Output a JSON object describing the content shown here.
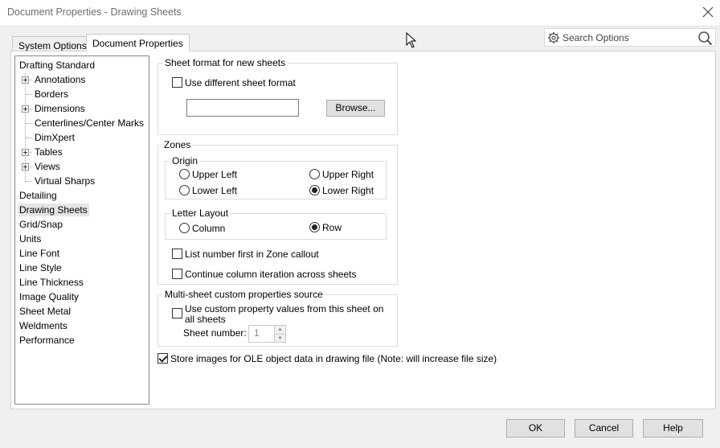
{
  "window": {
    "title": "Document Properties - Drawing Sheets"
  },
  "tabs": [
    {
      "label": "System Options",
      "active": false
    },
    {
      "label": "Document Properties",
      "active": true
    }
  ],
  "search": {
    "placeholder": "Search Options"
  },
  "tree": {
    "items": [
      {
        "label": "Drafting Standard",
        "level": 0
      },
      {
        "label": "Annotations",
        "level": 1,
        "expandable": true
      },
      {
        "label": "Borders",
        "level": 1
      },
      {
        "label": "Dimensions",
        "level": 1,
        "expandable": true
      },
      {
        "label": "Centerlines/Center Marks",
        "level": 1
      },
      {
        "label": "DimXpert",
        "level": 1
      },
      {
        "label": "Tables",
        "level": 1,
        "expandable": true
      },
      {
        "label": "Views",
        "level": 1,
        "expandable": true
      },
      {
        "label": "Virtual Sharps",
        "level": 1
      },
      {
        "label": "Detailing",
        "level": 0
      },
      {
        "label": "Drawing Sheets",
        "level": 0,
        "selected": true
      },
      {
        "label": "Grid/Snap",
        "level": 0
      },
      {
        "label": "Units",
        "level": 0
      },
      {
        "label": "Line Font",
        "level": 0
      },
      {
        "label": "Line Style",
        "level": 0
      },
      {
        "label": "Line Thickness",
        "level": 0
      },
      {
        "label": "Image Quality",
        "level": 0
      },
      {
        "label": "Sheet Metal",
        "level": 0
      },
      {
        "label": "Weldments",
        "level": 0
      },
      {
        "label": "Performance",
        "level": 0
      }
    ]
  },
  "sheet_format": {
    "legend": "Sheet format for new sheets",
    "use_different_label": "Use different sheet format",
    "use_different_checked": false,
    "path_value": "",
    "browse_label": "Browse..."
  },
  "zones": {
    "legend": "Zones",
    "origin": {
      "legend": "Origin",
      "upper_left": "Upper Left",
      "upper_right": "Upper Right",
      "lower_left": "Lower Left",
      "lower_right": "Lower Right",
      "selected": "Lower Right"
    },
    "letter_layout": {
      "legend": "Letter Layout",
      "column": "Column",
      "row": "Row",
      "selected": "Row"
    },
    "list_number_first": "List number first in Zone callout",
    "list_number_first_checked": false,
    "continue_column": "Continue column iteration across sheets",
    "continue_column_checked": false
  },
  "multi_sheet": {
    "legend": "Multi-sheet custom properties source",
    "use_custom_line1": "Use custom property values from this sheet on",
    "use_custom_line2": "all sheets",
    "use_custom_checked": false,
    "sheet_number_label": "Sheet number:",
    "sheet_number_value": "1"
  },
  "store_images": {
    "label": "Store images for OLE object data in drawing file (Note: will increase file size)",
    "checked": true
  },
  "footer": {
    "ok": "OK",
    "cancel": "Cancel",
    "help": "Help"
  },
  "icons": {
    "close": "close-icon",
    "gear": "gear-icon",
    "search": "search-icon",
    "cursor": "mouse-cursor-icon"
  }
}
